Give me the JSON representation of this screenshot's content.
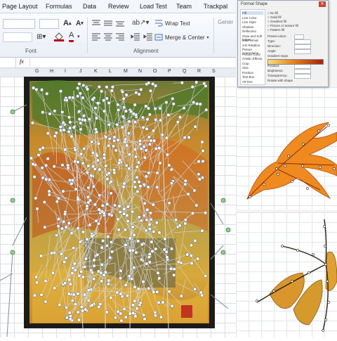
{
  "ribbon_tabs": [
    "Page Layout",
    "Formulas",
    "Data",
    "Review",
    "Load Test",
    "Team",
    "Trackpal"
  ],
  "ribbon": {
    "wrap_text": "Wrap Text",
    "merge_center": "Merge & Center",
    "general_partial": "Gener",
    "groups": [
      "Font",
      "Alignment"
    ]
  },
  "formula_bar": {
    "fx": "fx"
  },
  "columns": [
    "G",
    "H",
    "I",
    "J",
    "K",
    "L",
    "M",
    "N",
    "O",
    "P",
    "Q",
    "R",
    "S"
  ],
  "dialog": {
    "title": "Format Shape",
    "categories": [
      "Fill",
      "Line Color",
      "Line Style",
      "Shadow",
      "Reflection",
      "Glow and Soft Edges",
      "3-D Format",
      "3-D Rotation",
      "Picture Corrections",
      "Picture Color",
      "Artistic Effects",
      "Crop",
      "Size",
      "Position",
      "Text Box",
      "Alt Text"
    ],
    "fill_options": [
      "No fill",
      "Solid fill",
      "Gradient fill",
      "Picture or texture fill",
      "Pattern fill"
    ],
    "fields": [
      "Preset colors:",
      "Type:",
      "Direction:",
      "Angle:",
      "Gradient stops",
      "Color",
      "Position:",
      "Brightness:",
      "Transparency:",
      "Rotate with shape"
    ]
  },
  "colors": {
    "accent": "#2f6fbd",
    "ribbon": "#e9eef6",
    "leaf_orange": "#ef8a1e",
    "leaf_red": "#d93a16",
    "artwork_gold": "#d6a93a"
  }
}
